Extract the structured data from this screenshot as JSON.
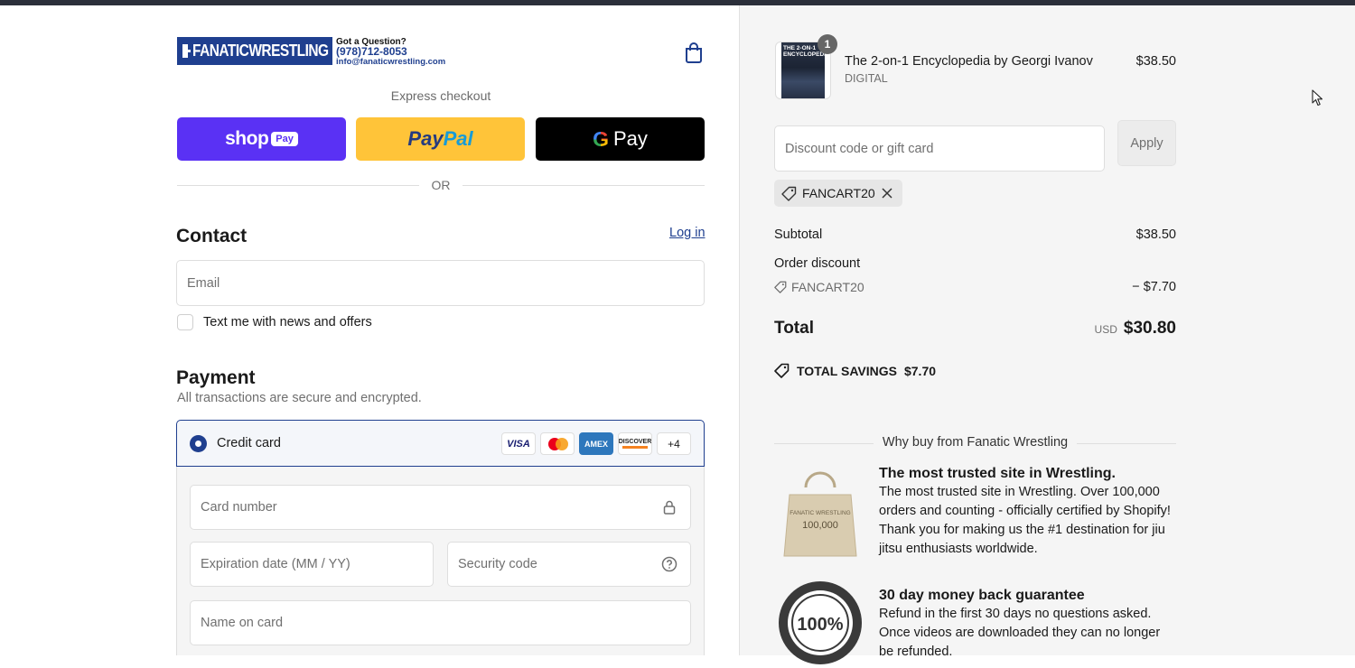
{
  "logo": {
    "brand": "FANATICWRESTLING",
    "question": "Got a Question?",
    "phone": "(978)712-8053",
    "email": "info@fanaticwrestling.com"
  },
  "express": {
    "label": "Express checkout",
    "shop_word": "shop",
    "shop_pay": "Pay",
    "paypal_a": "Pay",
    "paypal_b": "Pal",
    "gpay_g": "G",
    "gpay_word": "Pay",
    "or": "OR"
  },
  "contact": {
    "heading": "Contact",
    "login": "Log in",
    "email_placeholder": "Email",
    "sms_label": "Text me with news and offers"
  },
  "payment": {
    "heading": "Payment",
    "subtitle": "All transactions are secure and encrypted.",
    "method": "Credit card",
    "card_brands": [
      "VISA",
      "AMEX",
      "DISCOVER"
    ],
    "more_cards": "+4",
    "card_number_placeholder": "Card number",
    "expiry_placeholder": "Expiration date (MM / YY)",
    "cvc_placeholder": "Security code",
    "name_placeholder": "Name on card"
  },
  "cart": {
    "item": {
      "quantity": "1",
      "cover_text": "THE 2-ON-1 ENCYCLOPEDIA",
      "name": "The 2-on-1 Encyclopedia by Georgi Ivanov",
      "type": "DIGITAL",
      "price": "$38.50"
    },
    "discount_placeholder": "Discount code or gift card",
    "apply": "Apply",
    "applied_code": "FANCART20",
    "subtotal_label": "Subtotal",
    "subtotal": "$38.50",
    "order_discount_label": "Order discount",
    "discount_code": "FANCART20",
    "discount_amount": "− $7.70",
    "total_label": "Total",
    "currency": "USD",
    "total": "$30.80",
    "savings_label": "TOTAL SAVINGS",
    "savings": "$7.70"
  },
  "why": {
    "heading": "Why buy from Fanatic Wrestling",
    "features": [
      {
        "title": "The most trusted site in Wrestling.",
        "body": "The most trusted site in Wrestling. Over 100,000 orders and counting - officially certified by Shopify! Thank you for making us the #1 destination for jiu jitsu enthusiasts worldwide.",
        "image_text": "FANATIC WRESTLING",
        "image_number": "100,000"
      },
      {
        "title": "30 day money back guarantee",
        "body": "Refund in the first 30 days no questions asked. Once videos are downloaded they can no longer be refunded.",
        "image_text": "100%"
      }
    ]
  },
  "colors": {
    "accent": "#1f3f8f",
    "shop_pay": "#5a31f4",
    "paypal": "#ffc439",
    "gpay": "#000000"
  }
}
